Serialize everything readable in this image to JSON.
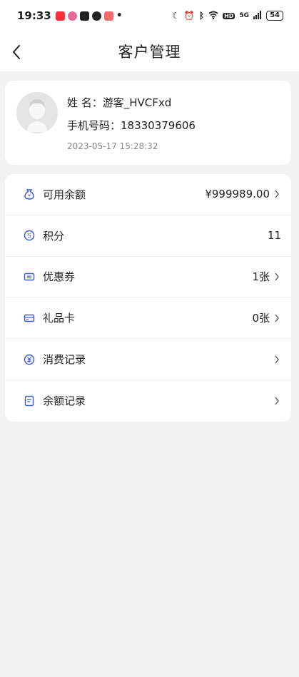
{
  "status_bar": {
    "time": "19:33",
    "network": "5G",
    "battery": "54",
    "app_colors": [
      "#f5323c",
      "#e8679b",
      "#222222",
      "#222222",
      "#f06b6b"
    ]
  },
  "nav": {
    "title": "客户管理",
    "back_icon": "chevron-left-icon"
  },
  "profile": {
    "name": "姓 名：游客_HVCFxd",
    "phone": "手机号码：18330379606",
    "time": "2023-05-17 15:28:32"
  },
  "menu": [
    {
      "label": "可用余额",
      "value": "¥999989.00",
      "icon": "money-bag-icon",
      "has_arrow": true
    },
    {
      "label": "积分",
      "value": "11",
      "icon": "points-coin-icon",
      "has_arrow": false
    },
    {
      "label": "优惠券",
      "value": "1张",
      "icon": "coupon-icon",
      "has_arrow": true
    },
    {
      "label": "礼品卡",
      "value": "0张",
      "icon": "gift-card-icon",
      "has_arrow": true
    },
    {
      "label": "消费记录",
      "value": "",
      "icon": "yen-circle-icon",
      "has_arrow": true
    },
    {
      "label": "余额记录",
      "value": "",
      "icon": "document-icon",
      "has_arrow": true
    }
  ],
  "accent_color": "#3b5bdb"
}
